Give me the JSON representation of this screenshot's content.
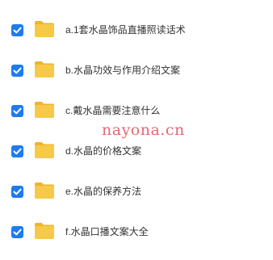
{
  "colors": {
    "checkbox": "#1e7bf0",
    "folder": "#f7c948",
    "folder_tab": "#f0b429",
    "text": "#333333",
    "watermark": "#e0505a"
  },
  "icons": {
    "checkbox": "checkbox-checked-icon",
    "folder": "folder-icon"
  },
  "files": [
    {
      "name": "a.1套水晶饰品直播照读话术",
      "checked": true
    },
    {
      "name": "b.水晶功效与作用介绍文案",
      "checked": true
    },
    {
      "name": "c.戴水晶需要注意什么",
      "checked": true
    },
    {
      "name": "d.水晶的价格文案",
      "checked": true
    },
    {
      "name": "e.水晶的保养方法",
      "checked": true
    },
    {
      "name": "f.水晶口播文案大全",
      "checked": true
    }
  ],
  "watermark": "nayona.cn"
}
